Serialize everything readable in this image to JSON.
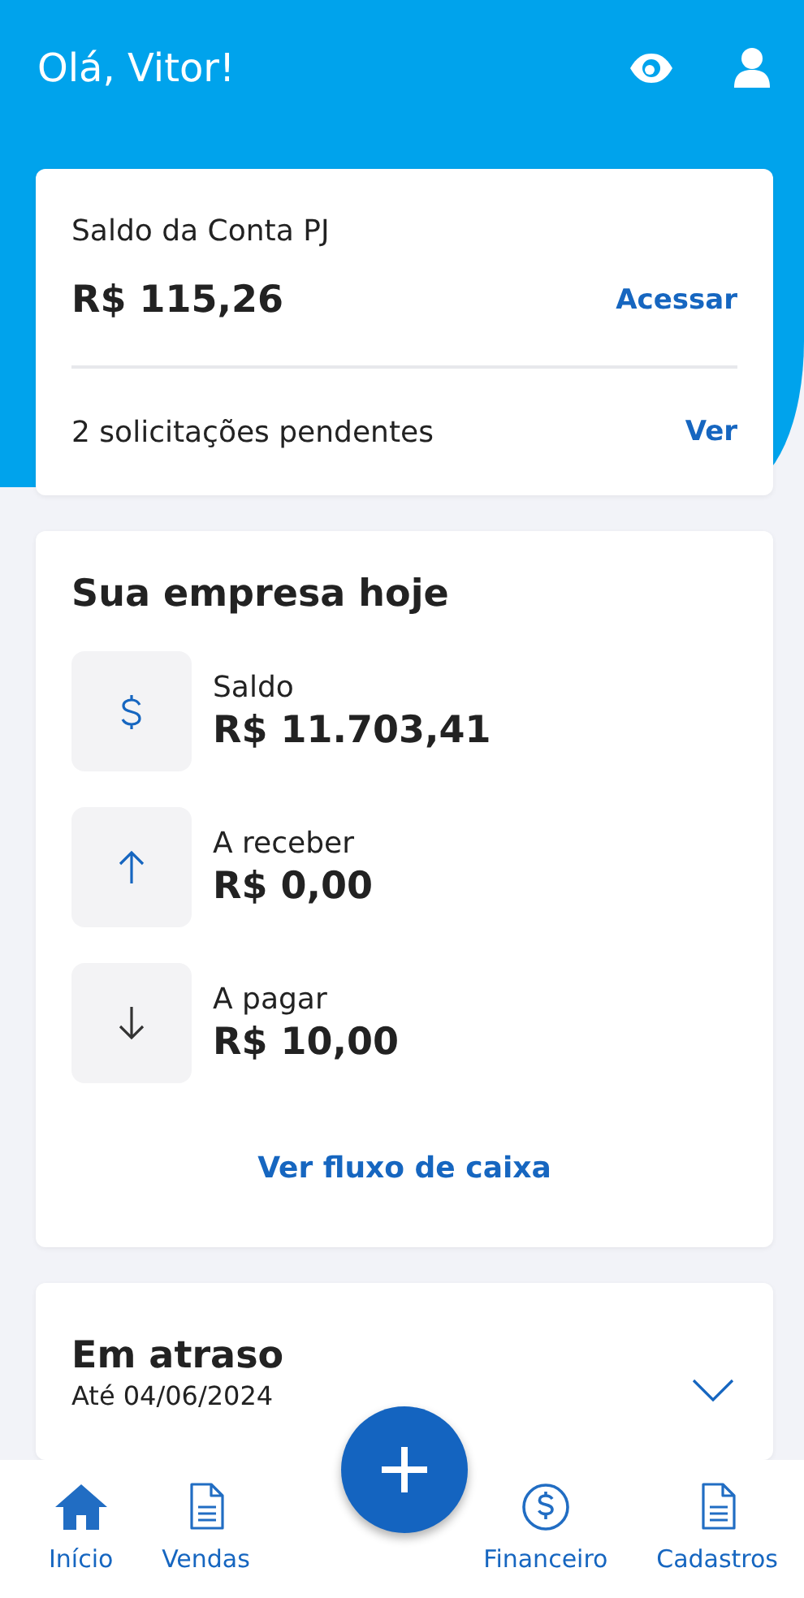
{
  "header": {
    "greeting": "Olá, Vitor!"
  },
  "account_card": {
    "title": "Saldo da Conta PJ",
    "balance": "R$ 115,26",
    "access_link": "Acessar",
    "requests": "2 solicitações pendentes",
    "requests_link": "Ver"
  },
  "company_card": {
    "title": "Sua empresa hoje",
    "items": [
      {
        "kind": "balance",
        "label": "Saldo",
        "value": "R$ 11.703,41"
      },
      {
        "kind": "receivable",
        "label": "A receber",
        "value": "R$ 0,00"
      },
      {
        "kind": "payable",
        "label": "A pagar",
        "value": "R$ 10,00"
      }
    ],
    "link": "Ver fluxo de caixa"
  },
  "overdue_card": {
    "title": "Em atraso",
    "subtitle": "Até 04/06/2024",
    "expanded": false
  },
  "bottom_nav": [
    {
      "kind": "home",
      "label": "Início"
    },
    {
      "kind": "document",
      "label": "Vendas"
    },
    {
      "kind": "money",
      "label": "Financeiro"
    },
    {
      "kind": "document",
      "label": "Cadastros"
    }
  ]
}
